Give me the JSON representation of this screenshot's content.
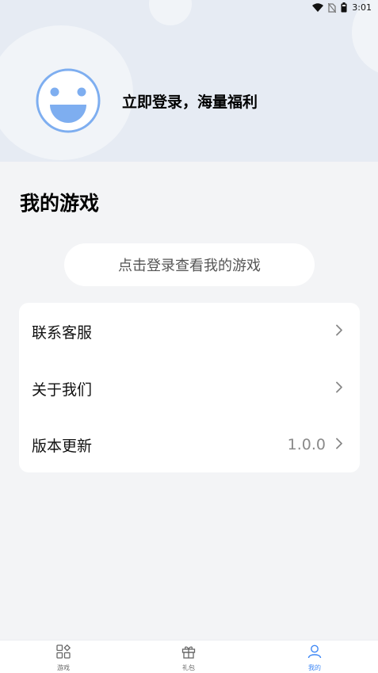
{
  "status_bar": {
    "time": "3:01",
    "icons": [
      "wifi-icon",
      "no-sim-icon",
      "battery-icon"
    ]
  },
  "header": {
    "login_prompt": "立即登录，海量福利",
    "avatar_icon": "smiley-avatar-icon",
    "colors": {
      "background": "#e6ebf3",
      "avatar_blue": "#7eaef0"
    }
  },
  "main": {
    "section_title": "我的游戏",
    "login_to_view": "点击登录查看我的游戏",
    "menu": [
      {
        "label": "联系客服",
        "value": ""
      },
      {
        "label": "关于我们",
        "value": ""
      },
      {
        "label": "版本更新",
        "value": "1.0.0"
      }
    ]
  },
  "bottom_nav": {
    "active_color": "#3f88f5",
    "tabs": [
      {
        "label": "游戏",
        "icon": "games-grid-icon",
        "active": false
      },
      {
        "label": "礼包",
        "icon": "gift-icon",
        "active": false
      },
      {
        "label": "我的",
        "icon": "person-icon",
        "active": true
      }
    ]
  }
}
